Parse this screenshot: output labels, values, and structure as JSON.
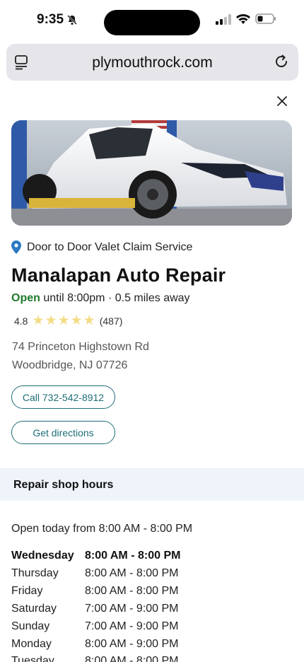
{
  "status_bar": {
    "time": "9:35"
  },
  "browser": {
    "url": "plymouthrock.com"
  },
  "listing": {
    "service": "Door to Door Valet Claim Service",
    "name": "Manalapan Auto Repair",
    "open_label": "Open",
    "open_rest": " until 8:00pm · 0.5 miles away",
    "rating": "4.8",
    "stars": 5,
    "reviews": "(487)",
    "address_line1": "74 Princeton Highstown Rd",
    "address_line2": "Woodbridge, NJ 07726",
    "call_label": "Call 732-542-8912",
    "directions_label": "Get directions"
  },
  "hours": {
    "heading": "Repair shop hours",
    "today": "Open today from 8:00 AM - 8:00 PM",
    "rows": [
      {
        "day": "Wednesday",
        "hours": "8:00 AM - 8:00 PM"
      },
      {
        "day": "Thursday",
        "hours": "8:00 AM - 8:00 PM"
      },
      {
        "day": "Friday",
        "hours": "8:00 AM - 8:00 PM"
      },
      {
        "day": "Saturday",
        "hours": "7:00 AM - 9:00 PM"
      },
      {
        "day": "Sunday",
        "hours": "7:00 AM - 9:00 PM"
      },
      {
        "day": "Monday",
        "hours": "8:00 AM - 9:00 PM"
      },
      {
        "day": "Tuesday",
        "hours": "8:00 AM - 8:00 PM"
      }
    ]
  },
  "colors": {
    "accent": "#1e6e78",
    "open": "#1d7a2b",
    "star": "#f3dc86",
    "band": "#eef4fa"
  }
}
